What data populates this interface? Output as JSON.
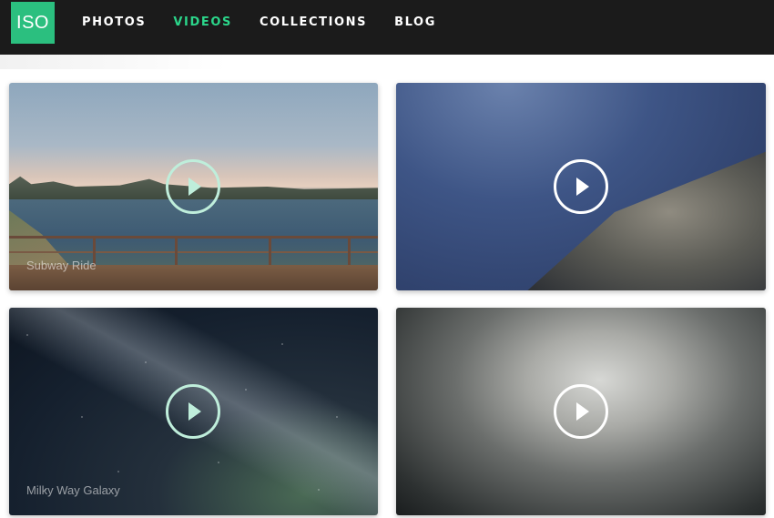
{
  "header": {
    "logo_text": "ISO",
    "nav": [
      {
        "label": "PHOTOS",
        "active": false
      },
      {
        "label": "VIDEOS",
        "active": true
      },
      {
        "label": "COLLECTIONS",
        "active": false
      },
      {
        "label": "BLOG",
        "active": false
      }
    ]
  },
  "colors": {
    "accent": "#2bbf7f",
    "active_nav": "#2bd58a",
    "header_bg": "#1b1b1b"
  },
  "videos": [
    {
      "caption": "Subway Ride",
      "icon": "play-icon"
    },
    {
      "caption": "",
      "icon": "play-icon"
    },
    {
      "caption": "Milky Way Galaxy",
      "icon": "play-icon"
    },
    {
      "caption": "",
      "icon": "play-icon"
    }
  ]
}
